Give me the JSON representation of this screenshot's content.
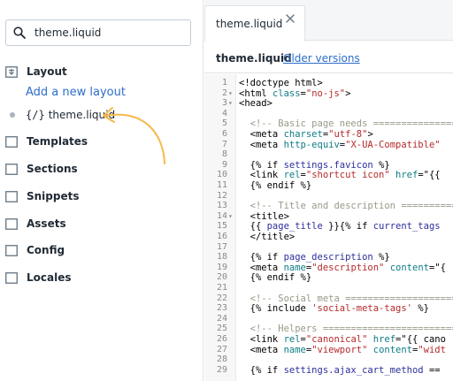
{
  "sidebar": {
    "search": {
      "value": "theme.liquid",
      "placeholder": ""
    },
    "layout_folder": "Layout",
    "add_layout": "Add a new layout",
    "active_file": {
      "prefix": "{/}",
      "name": "theme.liquid"
    },
    "folders": [
      "Templates",
      "Sections",
      "Snippets",
      "Assets",
      "Config",
      "Locales"
    ]
  },
  "editor": {
    "tab_label": "theme.liquid",
    "file_name": "theme.liquid",
    "older_versions": "Older versions",
    "lines": [
      {
        "n": "1",
        "fold": "",
        "segs": [
          [
            "",
            "<!doctype html>"
          ]
        ]
      },
      {
        "n": "2",
        "fold": "▾",
        "segs": [
          [
            "",
            "<html "
          ],
          [
            "n",
            "class"
          ],
          [
            "",
            "="
          ],
          [
            "s",
            "\"no-js\""
          ],
          [
            "",
            ">"
          ]
        ]
      },
      {
        "n": "3",
        "fold": "▾",
        "segs": [
          [
            "",
            "<head>"
          ]
        ]
      },
      {
        "n": "4",
        "fold": "",
        "segs": [
          [
            "",
            ""
          ]
        ]
      },
      {
        "n": "5",
        "fold": "",
        "segs": [
          [
            "c",
            "  <!-- Basic page needs =================="
          ]
        ]
      },
      {
        "n": "6",
        "fold": "",
        "segs": [
          [
            "",
            "  <meta "
          ],
          [
            "n",
            "charset"
          ],
          [
            "",
            "="
          ],
          [
            "s",
            "\"utf-8\""
          ],
          [
            "",
            ">"
          ]
        ]
      },
      {
        "n": "7",
        "fold": "",
        "segs": [
          [
            "",
            "  <meta "
          ],
          [
            "n",
            "http-equiv"
          ],
          [
            "",
            "="
          ],
          [
            "s",
            "\"X-UA-Compatible\""
          ]
        ]
      },
      {
        "n": "8",
        "fold": "",
        "segs": [
          [
            "",
            ""
          ]
        ]
      },
      {
        "n": "9",
        "fold": "",
        "segs": [
          [
            "",
            "  {% "
          ],
          [
            "k",
            "if "
          ],
          [
            "v",
            "settings.favicon"
          ],
          [
            "",
            " %}"
          ]
        ]
      },
      {
        "n": "10",
        "fold": "",
        "segs": [
          [
            "",
            "  <link "
          ],
          [
            "n",
            "rel"
          ],
          [
            "",
            "="
          ],
          [
            "s",
            "\"shortcut icon\""
          ],
          [
            "",
            " "
          ],
          [
            "n",
            "href"
          ],
          [
            "",
            "=\"{{ "
          ]
        ]
      },
      {
        "n": "11",
        "fold": "",
        "segs": [
          [
            "",
            "  {% "
          ],
          [
            "k",
            "endif"
          ],
          [
            "",
            " %}"
          ]
        ]
      },
      {
        "n": "12",
        "fold": "",
        "segs": [
          [
            "",
            ""
          ]
        ]
      },
      {
        "n": "13",
        "fold": "",
        "segs": [
          [
            "c",
            "  <!-- Title and description ============"
          ]
        ]
      },
      {
        "n": "14",
        "fold": "▾",
        "segs": [
          [
            "",
            "  <title>"
          ]
        ]
      },
      {
        "n": "15",
        "fold": "",
        "segs": [
          [
            "",
            "  {{ "
          ],
          [
            "v",
            "page_title"
          ],
          [
            "",
            " }}{% "
          ],
          [
            "k",
            "if "
          ],
          [
            "v",
            "current_tags"
          ]
        ]
      },
      {
        "n": "16",
        "fold": "",
        "segs": [
          [
            "",
            "  </title>"
          ]
        ]
      },
      {
        "n": "17",
        "fold": "",
        "segs": [
          [
            "",
            ""
          ]
        ]
      },
      {
        "n": "18",
        "fold": "",
        "segs": [
          [
            "",
            "  {% "
          ],
          [
            "k",
            "if "
          ],
          [
            "v",
            "page_description"
          ],
          [
            "",
            " %}"
          ]
        ]
      },
      {
        "n": "19",
        "fold": "",
        "segs": [
          [
            "",
            "  <meta "
          ],
          [
            "n",
            "name"
          ],
          [
            "",
            "="
          ],
          [
            "s",
            "\"description\""
          ],
          [
            "",
            " "
          ],
          [
            "n",
            "content"
          ],
          [
            "",
            "=\"{"
          ]
        ]
      },
      {
        "n": "20",
        "fold": "",
        "segs": [
          [
            "",
            "  {% "
          ],
          [
            "k",
            "endif"
          ],
          [
            "",
            " %}"
          ]
        ]
      },
      {
        "n": "21",
        "fold": "",
        "segs": [
          [
            "",
            ""
          ]
        ]
      },
      {
        "n": "22",
        "fold": "",
        "segs": [
          [
            "c",
            "  <!-- Social meta ======================"
          ]
        ]
      },
      {
        "n": "23",
        "fold": "",
        "segs": [
          [
            "",
            "  {% "
          ],
          [
            "k",
            "include "
          ],
          [
            "s",
            "'social-meta-tags'"
          ],
          [
            "",
            " %}"
          ]
        ]
      },
      {
        "n": "24",
        "fold": "",
        "segs": [
          [
            "",
            ""
          ]
        ]
      },
      {
        "n": "25",
        "fold": "",
        "segs": [
          [
            "c",
            "  <!-- Helpers =========================="
          ]
        ]
      },
      {
        "n": "26",
        "fold": "",
        "segs": [
          [
            "",
            "  <link "
          ],
          [
            "n",
            "rel"
          ],
          [
            "",
            "="
          ],
          [
            "s",
            "\"canonical\""
          ],
          [
            "",
            " "
          ],
          [
            "n",
            "href"
          ],
          [
            "",
            "=\"{{ cano"
          ]
        ]
      },
      {
        "n": "27",
        "fold": "",
        "segs": [
          [
            "",
            "  <meta "
          ],
          [
            "n",
            "name"
          ],
          [
            "",
            "="
          ],
          [
            "s",
            "\"viewport\""
          ],
          [
            "",
            " "
          ],
          [
            "n",
            "content"
          ],
          [
            "",
            "="
          ],
          [
            "s",
            "\"widt"
          ]
        ]
      },
      {
        "n": "28",
        "fold": "",
        "segs": [
          [
            "",
            ""
          ]
        ]
      },
      {
        "n": "29",
        "fold": "",
        "segs": [
          [
            "",
            "  {% "
          ],
          [
            "k",
            "if "
          ],
          [
            "v",
            "settings.ajax_cart_method"
          ],
          [
            "",
            " == "
          ]
        ]
      }
    ]
  }
}
